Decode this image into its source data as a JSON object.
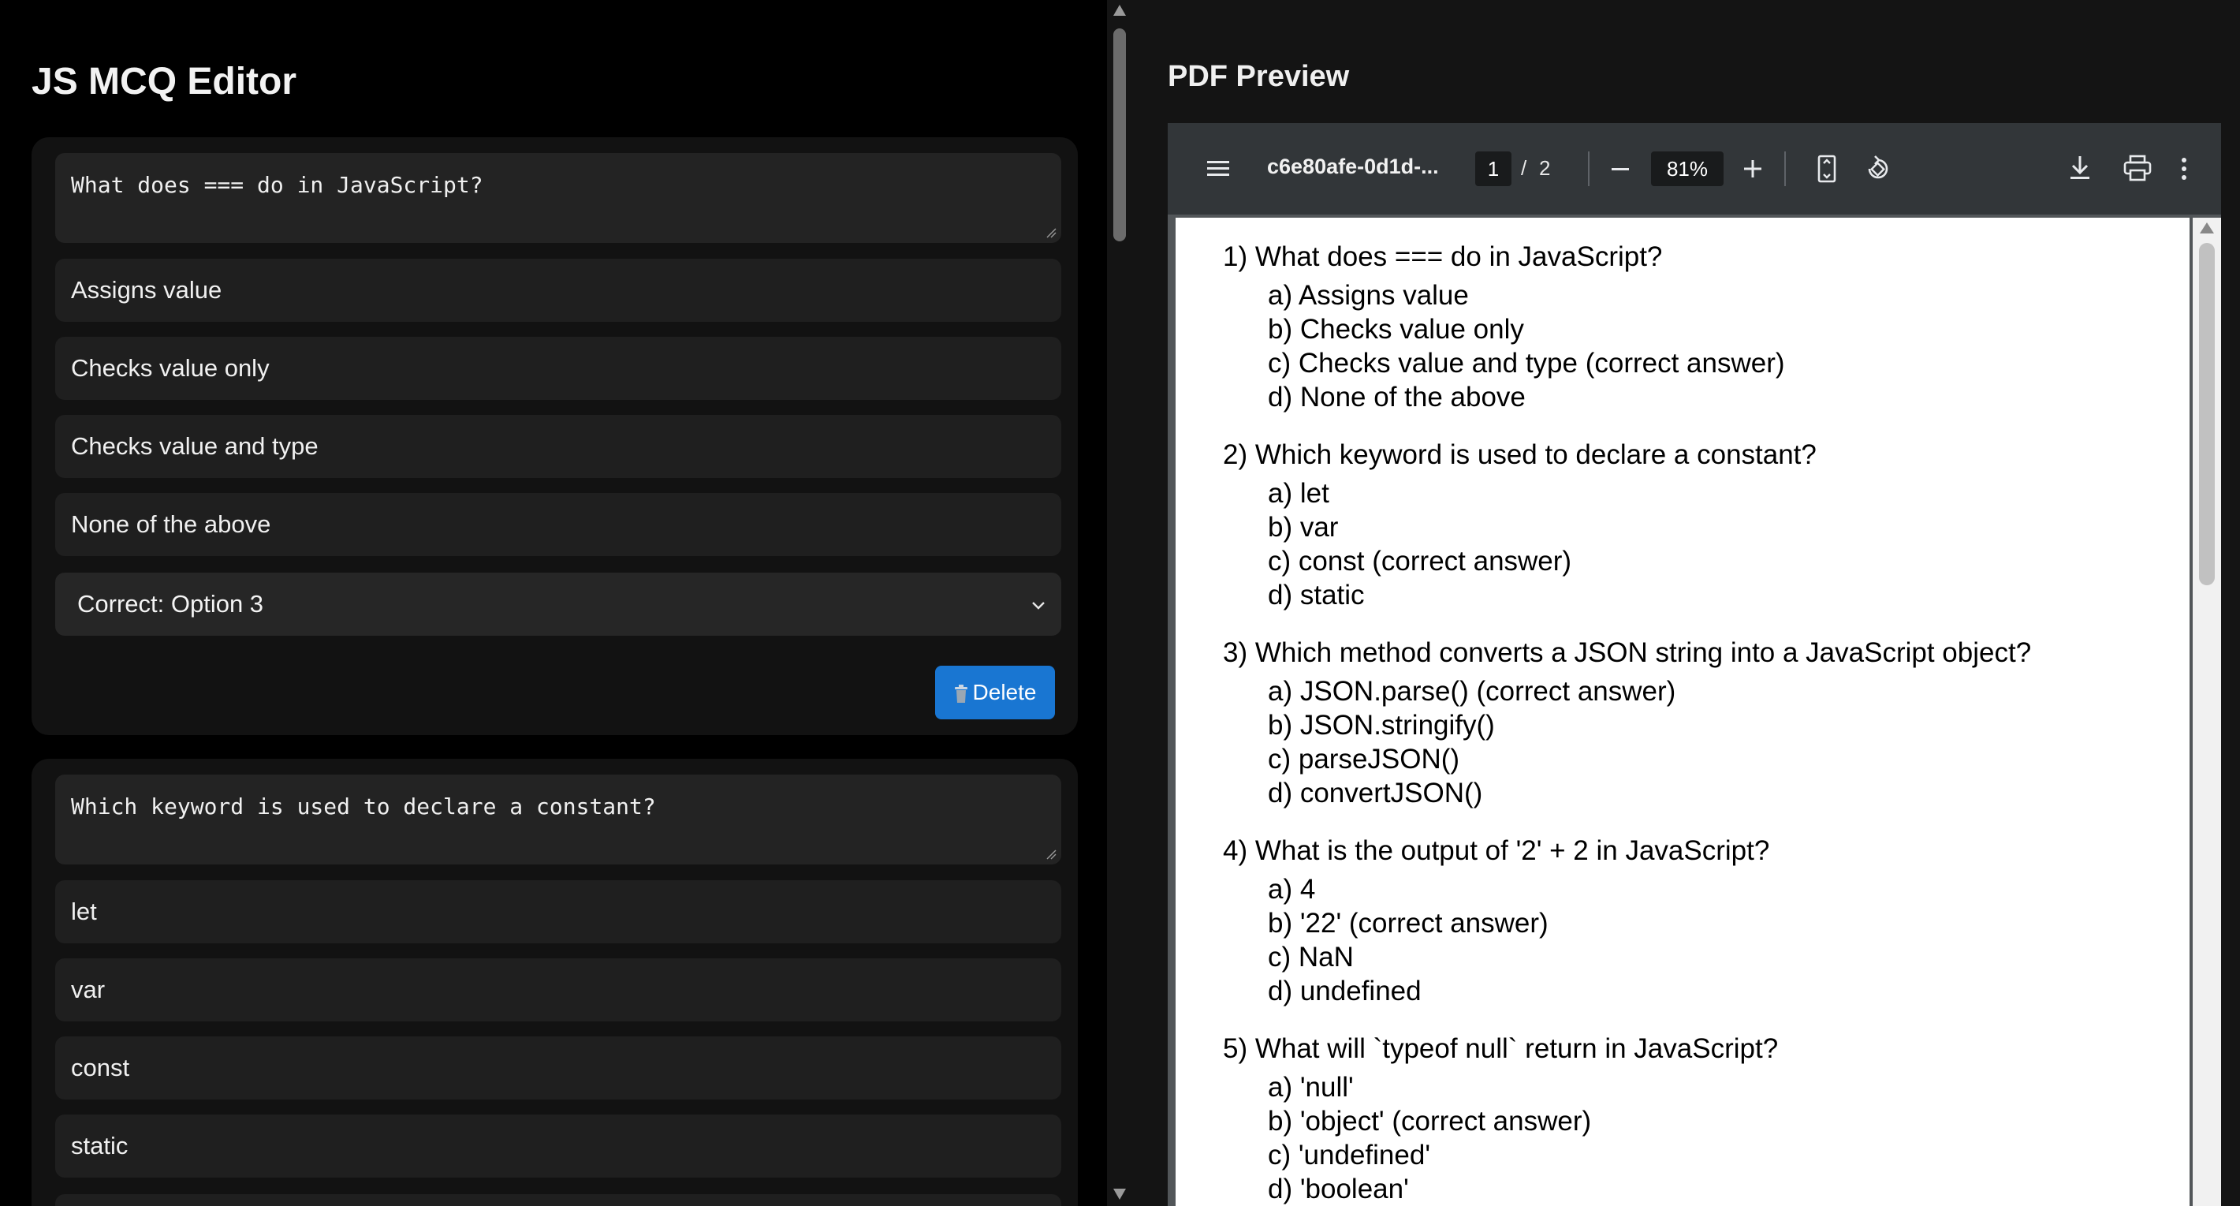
{
  "editor": {
    "title": "JS MCQ Editor",
    "questions": [
      {
        "question": "What does === do in JavaScript?",
        "options": [
          "Assigns value",
          "Checks value only",
          "Checks value and type",
          "None of the above"
        ],
        "correct_label": "Correct: Option 3",
        "delete_label": "Delete"
      },
      {
        "question": "Which keyword is used to declare a constant?",
        "options": [
          "let",
          "var",
          "const",
          "static"
        ]
      }
    ]
  },
  "preview": {
    "title": "PDF Preview",
    "toolbar": {
      "doc_name": "c6e80afe-0d1d-...",
      "page_current": "1",
      "page_sep": "/",
      "page_total": "2",
      "zoom": "81%"
    },
    "items": [
      {
        "q": "1) What does === do in JavaScript?",
        "a": [
          "a) Assigns value",
          "b) Checks value only",
          "c) Checks value and type (correct answer)",
          "d) None of the above"
        ]
      },
      {
        "q": "2) Which keyword is used to declare a constant?",
        "a": [
          "a) let",
          "b) var",
          "c) const (correct answer)",
          "d) static"
        ]
      },
      {
        "q": "3) Which method converts a JSON string into a JavaScript object?",
        "a": [
          "a) JSON.parse() (correct answer)",
          "b) JSON.stringify()",
          "c) parseJSON()",
          "d) convertJSON()"
        ]
      },
      {
        "q": "4) What is the output of '2' + 2 in JavaScript?",
        "a": [
          "a) 4",
          "b) '22' (correct answer)",
          "c) NaN",
          "d) undefined"
        ]
      },
      {
        "q": "5) What will `typeof null` return in JavaScript?",
        "a": [
          "a) 'null'",
          "b) 'object' (correct answer)",
          "c) 'undefined'",
          "d) 'boolean'"
        ]
      }
    ]
  },
  "colors": {
    "accent": "#1976d2",
    "card_bg": "#121212",
    "field_bg": "#1f1f1f",
    "viewer_toolbar": "#323639"
  }
}
